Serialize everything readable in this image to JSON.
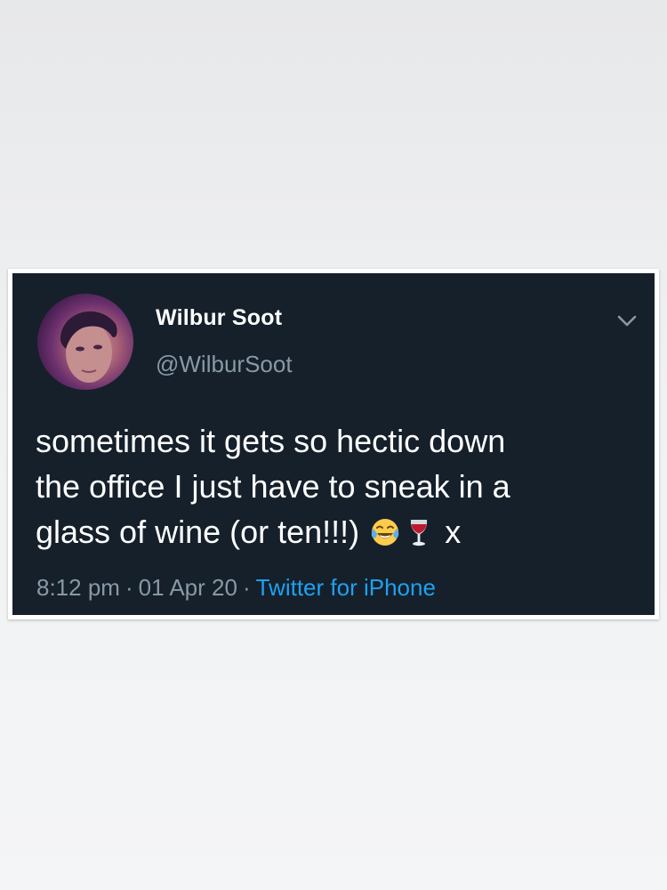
{
  "tweet": {
    "display_name": "Wilbur Soot",
    "handle": "@WilburSoot",
    "text_lines": [
      "sometimes it gets so hectic down",
      "the office I just have to sneak in a",
      "glass of wine (or ten!!!)"
    ],
    "text_suffix": "x",
    "emojis": [
      "face-with-tears-of-joy-icon",
      "wine-glass-icon"
    ],
    "time": "8:12 pm",
    "date": "01 Apr 20",
    "separator": "·",
    "source": "Twitter for iPhone"
  },
  "colors": {
    "tweet_background": "#15202b",
    "text": "#ffffff",
    "muted": "#8899a6",
    "link": "#1da1f2",
    "page_background": "#eeeff1"
  }
}
